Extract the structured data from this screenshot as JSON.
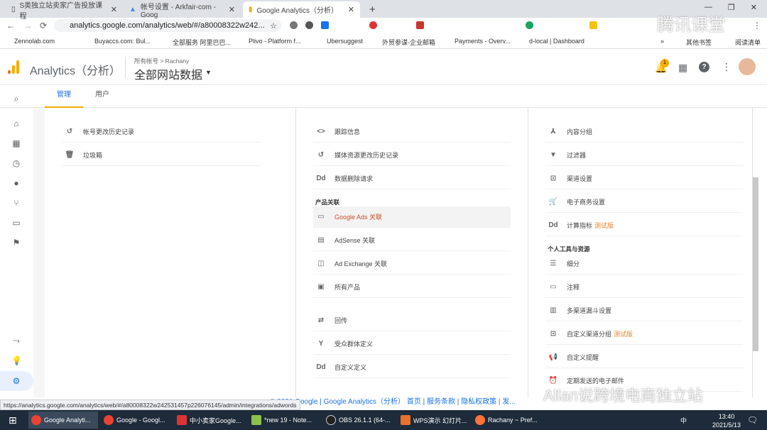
{
  "browser": {
    "tabs": [
      {
        "title": "S类独立站卖家广告投放课程"
      },
      {
        "title": "帐号设置 - Arkfair-com - Goog"
      },
      {
        "title": "Google Analytics（分析）"
      }
    ],
    "url": "analytics.google.com/analytics/web/#/a80008322w242...",
    "bookmarks": [
      "Zennolab.com",
      "Buyaccs.com: Bul...",
      "全部服务 阿里巴巴...",
      "Plivo - Platform f...",
      "Ubersuggest",
      "外贸参谋-企业邮箱",
      "Payments - Overv...",
      "d-local | Dashboard",
      "»",
      "其他书签",
      "阅读清单"
    ]
  },
  "ga": {
    "product": "Analytics（分析）",
    "breadcrumb": "所有帐号 > Rachany",
    "view": "全部网站数据",
    "notifications": "1"
  },
  "subtabs": [
    "管理",
    "用户"
  ],
  "col1": [
    {
      "icon": "↺",
      "name": "history-icon",
      "label": "帐号更改历史记录"
    },
    {
      "icon": "🗑",
      "name": "trash-icon",
      "label": "垃圾箱"
    }
  ],
  "col2": [
    {
      "icon": "<>",
      "name": "code-icon",
      "label": "跟踪信息"
    },
    {
      "icon": "↺",
      "name": "history-icon",
      "label": "媒体资源更改历史记录"
    },
    {
      "icon": "Dd",
      "name": "dd-icon",
      "label": "数据删除请求"
    },
    {
      "header": "产品关联"
    },
    {
      "icon": "▭",
      "name": "ads-icon",
      "label": "Google Ads 关联",
      "active": true
    },
    {
      "icon": "▤",
      "name": "adsense-icon",
      "label": "AdSense 关联"
    },
    {
      "icon": "◫",
      "name": "adexchange-icon",
      "label": "Ad Exchange 关联"
    },
    {
      "icon": "▣",
      "name": "products-icon",
      "label": "所有产品"
    },
    {
      "gap": true
    },
    {
      "icon": "⇄",
      "name": "postback-icon",
      "label": "回传"
    },
    {
      "icon": "Y",
      "name": "audience-icon",
      "label": "受众群体定义"
    },
    {
      "icon": "Dd",
      "name": "dd-icon",
      "label": "自定义定义"
    }
  ],
  "col3": [
    {
      "icon": "⅄",
      "name": "content-group-icon",
      "label": "内容分组"
    },
    {
      "icon": "▼",
      "name": "filter-icon",
      "label": "过滤器"
    },
    {
      "icon": "⊡",
      "name": "channel-icon",
      "label": "渠道设置"
    },
    {
      "icon": "🛒",
      "name": "cart-icon",
      "label": "电子商务设置"
    },
    {
      "icon": "Dd",
      "name": "dd-icon",
      "label": "计算指标",
      "beta": "测试版"
    },
    {
      "header": "个人工具与资源"
    },
    {
      "icon": "☰",
      "name": "segments-icon",
      "label": "细分"
    },
    {
      "icon": "▭",
      "name": "annotation-icon",
      "label": "注释"
    },
    {
      "icon": "▥",
      "name": "chart-icon",
      "label": "多渠道漏斗设置"
    },
    {
      "icon": "⊡",
      "name": "channel-icon",
      "label": "自定义渠道分组",
      "beta": "测试版"
    },
    {
      "icon": "📢",
      "name": "alert-icon",
      "label": "自定义提醒"
    },
    {
      "icon": "⏰",
      "name": "alarm-icon",
      "label": "定期发送的电子邮件"
    }
  ],
  "footer": "© 2021 Google | Google Analytics（分析） 首页 | 服务条款 | 隐私权政策 | 发...",
  "status_url": "https://analytics.google.com/analytics/web/#/a80008322w242531457p226076145/admin/integrations/adwords",
  "taskbar": {
    "items": [
      "Google Analyti...",
      "Google - Googl...",
      "中小卖家Google...",
      "*new 19 - Note...",
      "OBS 26.1.1 (64-...",
      "WPS演示 幻灯片...",
      "Rachany ~ Pref..."
    ],
    "time": "13:40",
    "date": "2021/5/13",
    "ime": "中"
  },
  "watermarks": [
    "腾讯课堂",
    "Allan说跨境电商独立站"
  ]
}
